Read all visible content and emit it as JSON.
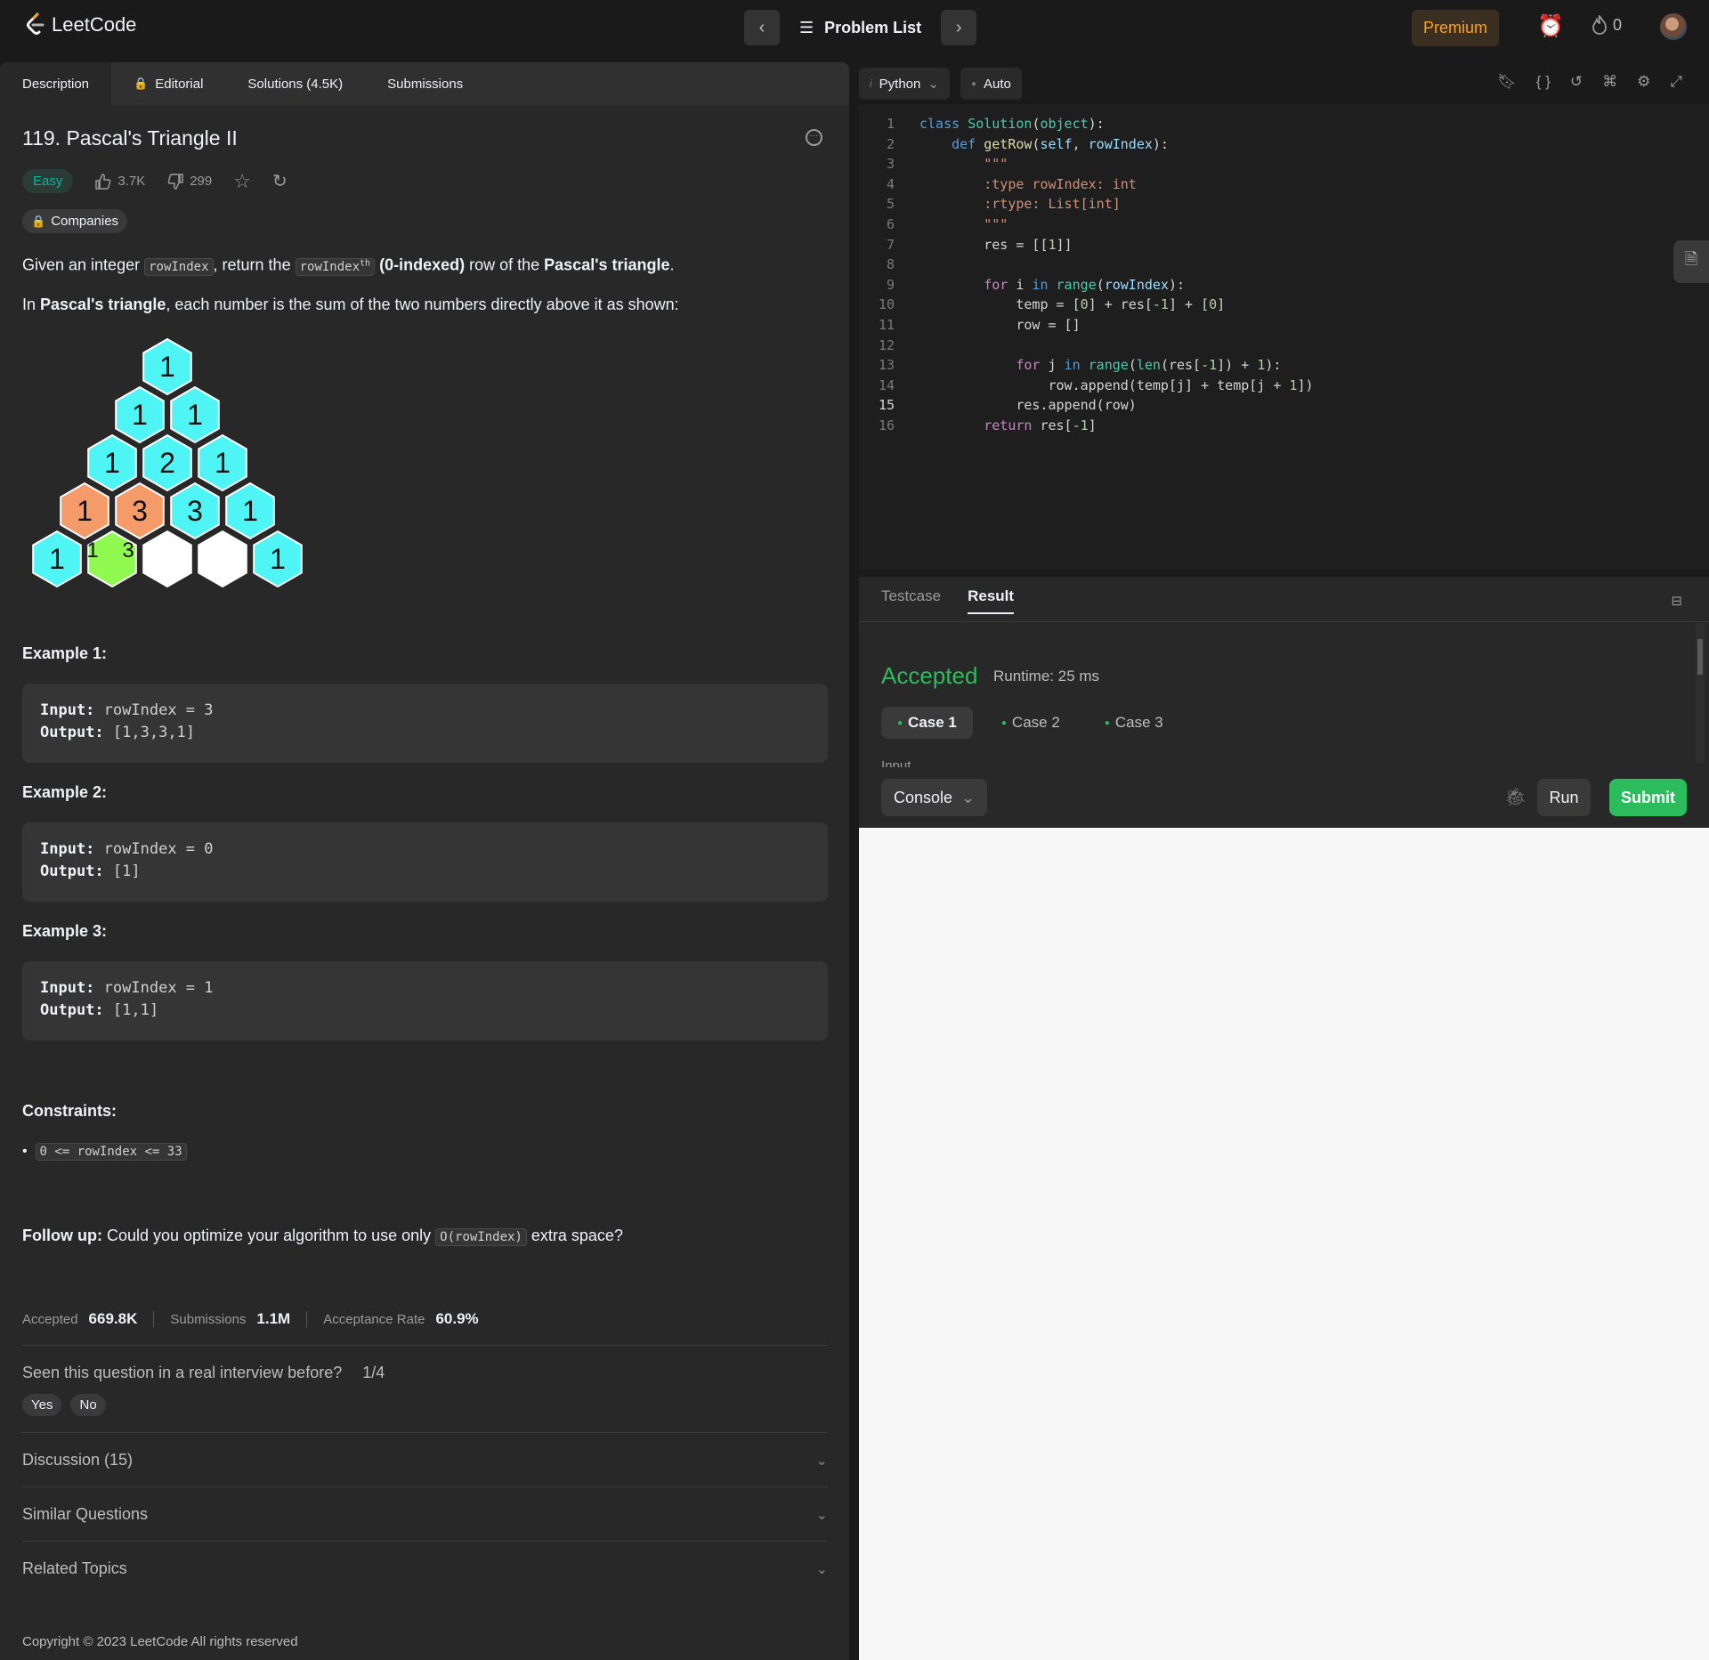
{
  "nav": {
    "logo_text": "LeetCode",
    "problem_list": "Problem List",
    "premium": "Premium",
    "streak_count": "0"
  },
  "tabs": {
    "description": "Description",
    "editorial": "Editorial",
    "solutions": "Solutions (4.5K)",
    "submissions": "Submissions"
  },
  "problem": {
    "title": "119. Pascal's Triangle II",
    "difficulty": "Easy",
    "likes": "3.7K",
    "dislikes": "299",
    "companies": "Companies",
    "desc_1_a": "Given an integer ",
    "desc_1_code": "rowIndex",
    "desc_1_b": ", return the ",
    "desc_1_code2": "rowIndex",
    "desc_1_sup": "th",
    "desc_1_c": "(0-indexed)",
    "desc_1_d": " row of the ",
    "desc_1_e": "Pascal's triangle",
    "desc_1_f": ".",
    "desc_2_a": "In ",
    "desc_2_b": "Pascal's triangle",
    "desc_2_c": ", each number is the sum of the two numbers directly above it as shown:"
  },
  "triangle_numbers": [
    "1",
    "1",
    "1",
    "1",
    "2",
    "1",
    "1",
    "3",
    "3",
    "1",
    "1",
    "1",
    "3",
    "1"
  ],
  "triangle_colors": {
    "cyan": "#4ff4f4",
    "orange": "#f59b6a",
    "green": "#90f950",
    "white": "#ffffff"
  },
  "examples": [
    {
      "head": "Example 1:",
      "input_label": "Input:",
      "input": "rowIndex = 3",
      "output_label": "Output:",
      "output": "[1,3,3,1]"
    },
    {
      "head": "Example 2:",
      "input_label": "Input:",
      "input": "rowIndex = 0",
      "output_label": "Output:",
      "output": "[1]"
    },
    {
      "head": "Example 3:",
      "input_label": "Input:",
      "input": "rowIndex = 1",
      "output_label": "Output:",
      "output": "[1,1]"
    }
  ],
  "constraints": {
    "head": "Constraints:",
    "item": "0 <= rowIndex <= 33"
  },
  "followup": {
    "label": "Follow up:",
    "text_a": " Could you optimize your algorithm to use only ",
    "code": "O(rowIndex)",
    "text_b": " extra space?"
  },
  "stats": {
    "accepted_label": "Accepted",
    "accepted": "669.8K",
    "submissions_label": "Submissions",
    "submissions": "1.1M",
    "rate_label": "Acceptance Rate",
    "rate": "60.9%"
  },
  "interview": {
    "question": "Seen this question in a real interview before?",
    "count": "1/4",
    "yes": "Yes",
    "no": "No"
  },
  "accordions": {
    "discussion": "Discussion (15)",
    "similar": "Similar Questions",
    "topics": "Related Topics"
  },
  "copyright": "Copyright © 2023 LeetCode All rights reserved",
  "editor": {
    "language": "Python",
    "mode": "Auto",
    "line_numbers": [
      "1",
      "2",
      "3",
      "4",
      "5",
      "6",
      "7",
      "8",
      "9",
      "10",
      "11",
      "12",
      "13",
      "14",
      "15",
      "16"
    ],
    "code_lines": [
      "class Solution(object):",
      "    def getRow(self, rowIndex):",
      "        \"\"\"",
      "        :type rowIndex: int",
      "        :rtype: List[int]",
      "        \"\"\"",
      "        res = [[1]]",
      "",
      "        for i in range(rowIndex):",
      "            temp = [0] + res[-1] + [0]",
      "            row = []",
      "",
      "            for j in range(len(res[-1]) + 1):",
      "                row.append(temp[j] + temp[j + 1])",
      "            res.append(row)",
      "        return res[-1]"
    ]
  },
  "result": {
    "tab_testcase": "Testcase",
    "tab_result": "Result",
    "status": "Accepted",
    "runtime": "Runtime: 25 ms",
    "cases": [
      "Case 1",
      "Case 2",
      "Case 3"
    ],
    "input_label": "Input",
    "console": "Console",
    "run": "Run",
    "submit": "Submit"
  }
}
